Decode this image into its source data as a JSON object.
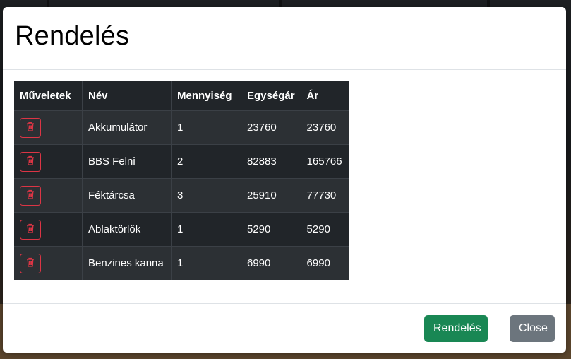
{
  "modal": {
    "title": "Rendelés"
  },
  "table": {
    "headers": {
      "actions": "Műveletek",
      "name": "Név",
      "quantity": "Mennyiség",
      "unit_price": "Egységár",
      "price": "Ár"
    },
    "rows": [
      {
        "name": "Akkumulátor",
        "quantity": "1",
        "unit_price": "23760",
        "price": "23760",
        "action_icon": "trash-icon"
      },
      {
        "name": "BBS Felni",
        "quantity": "2",
        "unit_price": "82883",
        "price": "165766",
        "action_icon": "trash-icon"
      },
      {
        "name": "Féktárcsa",
        "quantity": "3",
        "unit_price": "25910",
        "price": "77730",
        "action_icon": "trash-icon"
      },
      {
        "name": "Ablaktörlők",
        "quantity": "1",
        "unit_price": "5290",
        "price": "5290",
        "action_icon": "trash-icon"
      },
      {
        "name": "Benzines kanna",
        "quantity": "1",
        "unit_price": "6990",
        "price": "6990",
        "action_icon": "trash-icon"
      }
    ]
  },
  "footer": {
    "order_label": "Rendelés",
    "close_label": "Close"
  },
  "colors": {
    "table_bg": "#212529",
    "table_stripe": "#2c3034",
    "danger": "#dc3545",
    "success": "#198754",
    "secondary": "#6c757d"
  }
}
